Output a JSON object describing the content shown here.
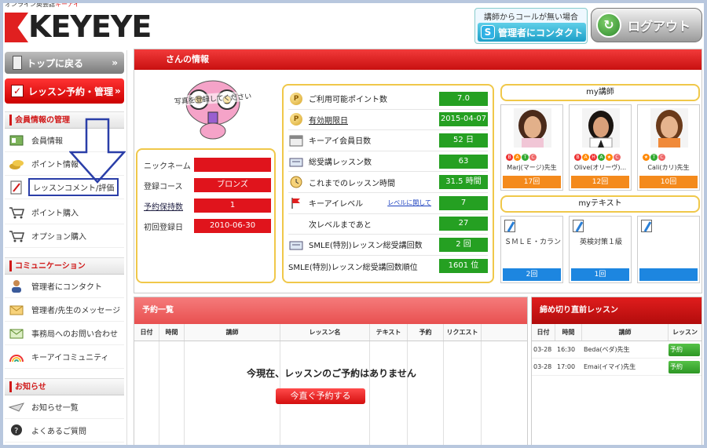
{
  "header": {
    "tagline_prefix": "オンライン英会話",
    "tagline_brand": "キーアイ",
    "logo_text": "KEYEYE",
    "contact_notice": "講師からコールが無い場合",
    "contact_skype_letter": "S",
    "contact_button": "管理者にコンタクト",
    "logout_button": "ログアウト"
  },
  "sidebar": {
    "top_button": "トップに戻る",
    "lesson_button": "レッスン予約・管理",
    "sections": [
      {
        "title": "会員情報の管理",
        "items": [
          "会員情報",
          "ポイント情報",
          "レッスンコメント/評価",
          "ポイント購入",
          "オプション購入"
        ]
      },
      {
        "title": "コミュニケーション",
        "items": [
          "管理者にコンタクト",
          "管理者/先生のメッセージ",
          "事務局へのお問い合わせ",
          "キーアイコミュニティ"
        ]
      },
      {
        "title": "お知らせ",
        "items": [
          "お知らせ一覧",
          "よくあるご質問"
        ]
      }
    ]
  },
  "info": {
    "title": "さんの情報",
    "avatar_caption": "写真を登録してください",
    "profile": [
      {
        "label": "ニックネーム",
        "value": ""
      },
      {
        "label": "登録コース",
        "value": "ブロンズ"
      },
      {
        "label": "予約保持数",
        "value": "1"
      },
      {
        "label": "初回登録日",
        "value": "2010-06-30"
      }
    ],
    "stats": [
      {
        "label": "ご利用可能ポイント数",
        "value": "7.0"
      },
      {
        "label": "有効期限日",
        "value": "2015-04-07"
      },
      {
        "label": "キーアイ会員日数",
        "value": "52 日"
      },
      {
        "label": "総受講レッスン数",
        "value": "63"
      },
      {
        "label": "これまでのレッスン時間",
        "value": "31.5 時間"
      },
      {
        "label": "キーアイレベル",
        "link": "レベルに関して",
        "value": "7"
      },
      {
        "label": "次レベルまであと",
        "value": "27"
      },
      {
        "label": "SMLE(特別)レッスン総受講回数",
        "value": "2 回"
      },
      {
        "label": "SMLE(特別)レッスン総受講回数順位",
        "value": "1601 位"
      }
    ],
    "my_teacher_title": "my講師",
    "teachers": [
      {
        "name": "Marj(マージ)先生",
        "count": "17回"
      },
      {
        "name": "Olive(オリーヴ)...",
        "count": "12回"
      },
      {
        "name": "Cali(カリ)先生",
        "count": "10回"
      }
    ],
    "my_text_title": "myテキスト",
    "texts": [
      {
        "title": "ＳＭＬＥ・カラン",
        "count": "2回"
      },
      {
        "title": "英検対策１級",
        "count": "1回"
      },
      {
        "title": "",
        "count": ""
      }
    ]
  },
  "reservations": {
    "title": "予約一覧",
    "columns": [
      "日付",
      "時間",
      "講師",
      "レッスン名",
      "テキスト",
      "予約",
      "リクエスト"
    ],
    "empty_message": "今現在、レッスンのご予約はありません",
    "book_now": "今直ぐ予約する"
  },
  "closing": {
    "title": "締め切り直前レッスン",
    "columns": [
      "日付",
      "時間",
      "講師",
      "レッスン"
    ],
    "rows": [
      {
        "date": "03-28",
        "time": "16:30",
        "teacher": "Beda(ベダ)先生",
        "action": "予約"
      },
      {
        "date": "03-28",
        "time": "17:00",
        "teacher": "Emai(イマイ)先生",
        "action": "予約"
      }
    ]
  },
  "colors": {
    "brand_red": "#e02020",
    "stat_green": "#25a022",
    "count_orange": "#f48a1c",
    "count_blue": "#1d86e0"
  }
}
